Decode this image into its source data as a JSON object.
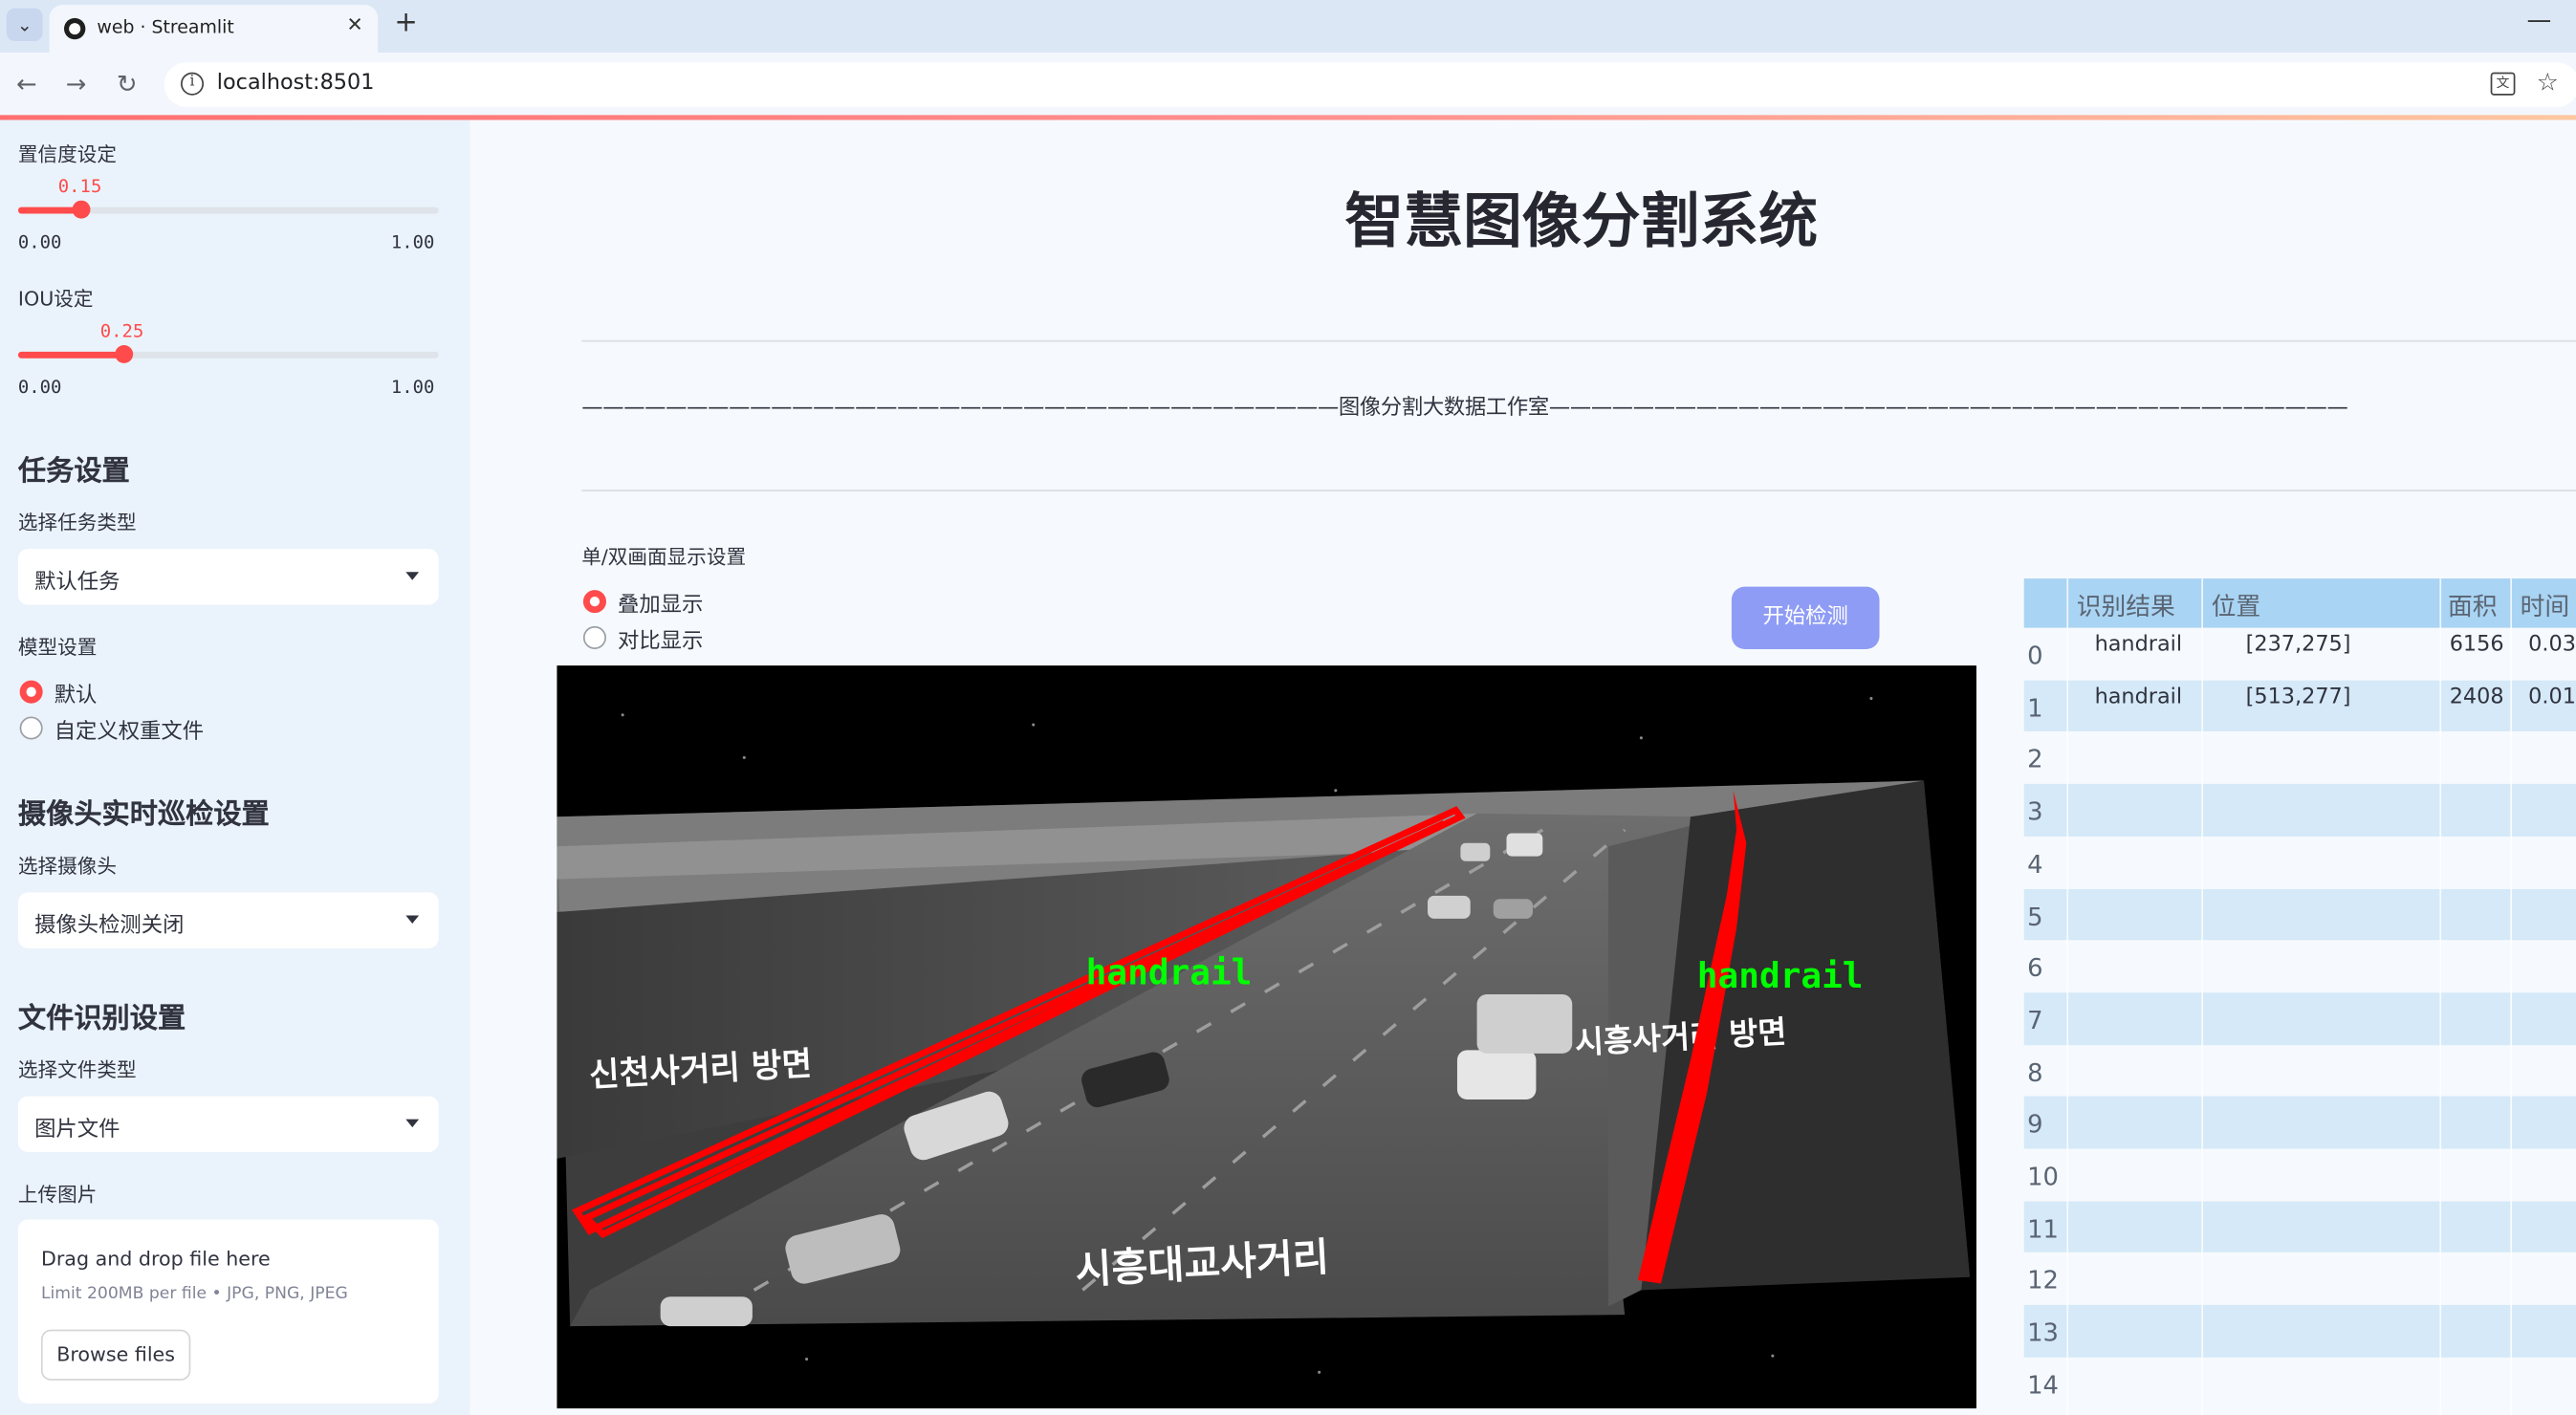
{
  "browser": {
    "tab_title": "web · Streamlit",
    "url": "localhost:8501"
  },
  "sidebar": {
    "confidence": {
      "label": "置信度设定",
      "value": "0.15",
      "min": "0.00",
      "max": "1.00",
      "fraction": 0.15
    },
    "iou": {
      "label": "IOU设定",
      "value": "0.25",
      "min": "0.00",
      "max": "1.00",
      "fraction": 0.25
    },
    "task_section": {
      "title": "任务设置",
      "select_label": "选择任务类型",
      "selected": "默认任务"
    },
    "model_section": {
      "label": "模型设置",
      "options": [
        "默认",
        "自定义权重文件"
      ],
      "selected_index": 0
    },
    "camera_section": {
      "title": "摄像头实时巡检设置",
      "select_label": "选择摄像头",
      "selected": "摄像头检测关闭"
    },
    "file_section": {
      "title": "文件识别设置",
      "select_label": "选择文件类型",
      "selected": "图片文件",
      "upload_label": "上传图片"
    },
    "uploader": {
      "title": "Drag and drop file here",
      "limit": "Limit 200MB per file • JPG, PNG, JPEG",
      "button": "Browse files"
    }
  },
  "main": {
    "title": "智慧图像分割系统",
    "banner": "————————————————————————————————————图像分割大数据工作室——————————————————————————————————————",
    "display_setting": {
      "label": "单/双画面显示设置",
      "options": [
        "叠加显示",
        "对比显示"
      ],
      "selected_index": 0
    },
    "start_button": "开始检测",
    "image": {
      "detections": [
        {
          "label": "handrail",
          "color": "#ff0000"
        },
        {
          "label": "handrail",
          "color": "#ff0000"
        }
      ],
      "label_color": "#00ff00",
      "signs": [
        "신천사거리 방면",
        "시흥사거리 방면",
        "시흥대교사거리"
      ]
    }
  },
  "results_table": {
    "columns": [
      "识别结果",
      "位置",
      "面积",
      "时间"
    ],
    "rows": [
      {
        "index": "0",
        "label": "handrail",
        "position": "[237,275]",
        "area": "6156",
        "time": "0.03"
      },
      {
        "index": "1",
        "label": "handrail",
        "position": "[513,277]",
        "area": "2408",
        "time": "0.01"
      },
      {
        "index": "2",
        "label": "",
        "position": "",
        "area": "",
        "time": ""
      },
      {
        "index": "3",
        "label": "",
        "position": "",
        "area": "",
        "time": ""
      },
      {
        "index": "4",
        "label": "",
        "position": "",
        "area": "",
        "time": ""
      },
      {
        "index": "5",
        "label": "",
        "position": "",
        "area": "",
        "time": ""
      },
      {
        "index": "6",
        "label": "",
        "position": "",
        "area": "",
        "time": ""
      },
      {
        "index": "7",
        "label": "",
        "position": "",
        "area": "",
        "time": ""
      },
      {
        "index": "8",
        "label": "",
        "position": "",
        "area": "",
        "time": ""
      },
      {
        "index": "9",
        "label": "",
        "position": "",
        "area": "",
        "time": ""
      },
      {
        "index": "10",
        "label": "",
        "position": "",
        "area": "",
        "time": ""
      },
      {
        "index": "11",
        "label": "",
        "position": "",
        "area": "",
        "time": ""
      },
      {
        "index": "12",
        "label": "",
        "position": "",
        "area": "",
        "time": ""
      },
      {
        "index": "13",
        "label": "",
        "position": "",
        "area": "",
        "time": ""
      },
      {
        "index": "14",
        "label": "",
        "position": "",
        "area": "",
        "time": ""
      }
    ],
    "stripe_color": "#d5e9f8"
  }
}
